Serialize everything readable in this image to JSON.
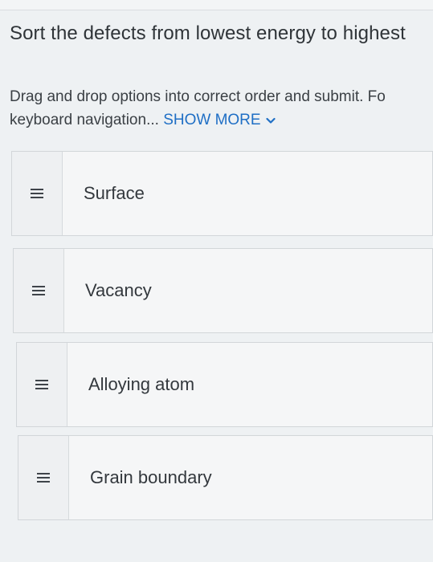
{
  "question": {
    "title": "Sort the defects from lowest energy to highest",
    "instructions_line1": "Drag and drop options into correct order and submit. Fo",
    "instructions_line2": "keyboard navigation...",
    "show_more": "SHOW MORE"
  },
  "options": [
    {
      "label": "Surface"
    },
    {
      "label": "Vacancy"
    },
    {
      "label": "Alloying atom"
    },
    {
      "label": "Grain boundary"
    }
  ],
  "colors": {
    "link": "#1f6fc5",
    "background": "#eef1f3",
    "card": "#f5f6f7"
  },
  "icons": {
    "handle": "drag-handle-icon",
    "show_more": "chevron-down-icon"
  }
}
